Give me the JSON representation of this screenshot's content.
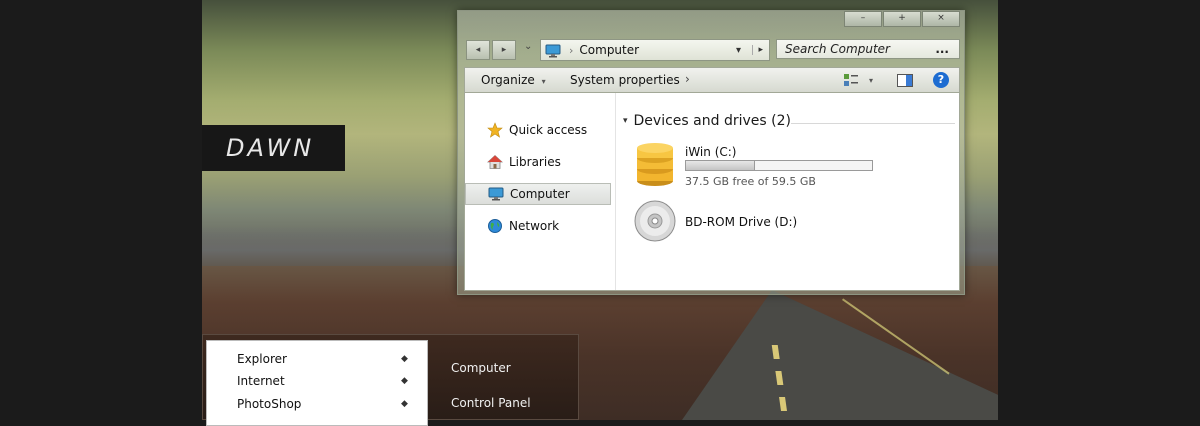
{
  "brand": {
    "label": "DAWN"
  },
  "window": {
    "caption": {
      "minimize": "–",
      "maximize": "+",
      "close": "×"
    },
    "nav": {
      "back": "◂",
      "forward": "▸",
      "history": "⌄"
    },
    "address": {
      "location": "Computer",
      "separator": "›",
      "dropdown": "▾",
      "refresh": "▸"
    },
    "search": {
      "placeholder": "Search Computer",
      "more": "..."
    },
    "toolbar": {
      "organize": "Organize",
      "organize_arrow": "▾",
      "system_properties": "System properties",
      "overflow": "›",
      "views_arrow": "▾",
      "help": "?"
    },
    "navpane": {
      "items": [
        {
          "label": "Quick access"
        },
        {
          "label": "Libraries"
        },
        {
          "label": "Computer"
        },
        {
          "label": "Network"
        }
      ]
    },
    "section": {
      "arrow": "▾",
      "title": "Devices and drives (2)"
    },
    "drives": [
      {
        "name": "iWin (C:)",
        "free": "37.5 GB free of 59.5 GB",
        "used_fraction": 0.37
      },
      {
        "name": "BD-ROM Drive (D:)"
      }
    ]
  },
  "startmenu": {
    "programs": [
      {
        "label": "Explorer",
        "arrow": "◆"
      },
      {
        "label": "Internet",
        "arrow": "◆"
      },
      {
        "label": "PhotoShop",
        "arrow": "◆"
      }
    ],
    "right_items": [
      {
        "label": "Computer"
      },
      {
        "label": "Control Panel"
      }
    ]
  }
}
